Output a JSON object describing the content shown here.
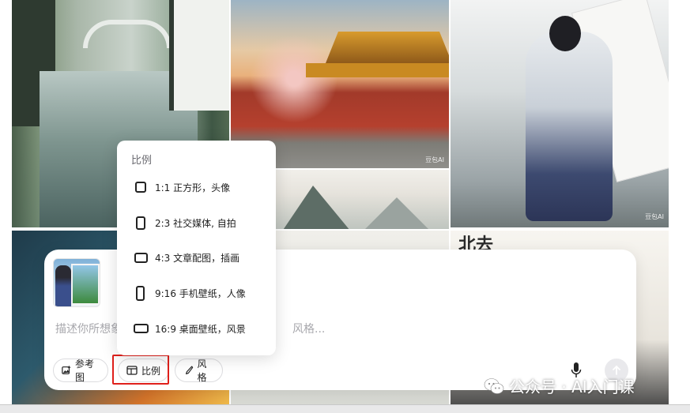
{
  "gallery": {
    "tiles": [
      {
        "name": "canal-town",
        "watermark": ""
      },
      {
        "name": "forbidden-palace",
        "watermark": "豆包AI"
      },
      {
        "name": "ink-mountains",
        "watermark": ""
      },
      {
        "name": "scholar-hanfu",
        "watermark": "豆包AI"
      },
      {
        "name": "poster-art",
        "watermark": ""
      },
      {
        "name": "ink-scenery",
        "watermark": ""
      },
      {
        "name": "calligraphy",
        "watermark": ""
      }
    ],
    "calligraphy_text": "北去"
  },
  "ratio_menu": {
    "title": "比例",
    "options": [
      {
        "label": "1:1 正方形，头像",
        "shape": "square"
      },
      {
        "label": "2:3 社交媒体, 自拍",
        "shape": "portrait-2-3"
      },
      {
        "label": "4:3 文章配图，插画",
        "shape": "landscape-4-3"
      },
      {
        "label": "9:16 手机壁纸，人像",
        "shape": "portrait-9-16"
      },
      {
        "label": "16:9 桌面壁纸，风景",
        "shape": "landscape-16-9"
      }
    ]
  },
  "composer": {
    "prompt_head": "描述你所想象",
    "prompt_tail": "风格...",
    "buttons": {
      "reference": "参考图",
      "ratio": "比例",
      "style": "风格"
    },
    "highlight_color": "#e0201b"
  },
  "brand_watermark": "公众号 · AI入门课"
}
